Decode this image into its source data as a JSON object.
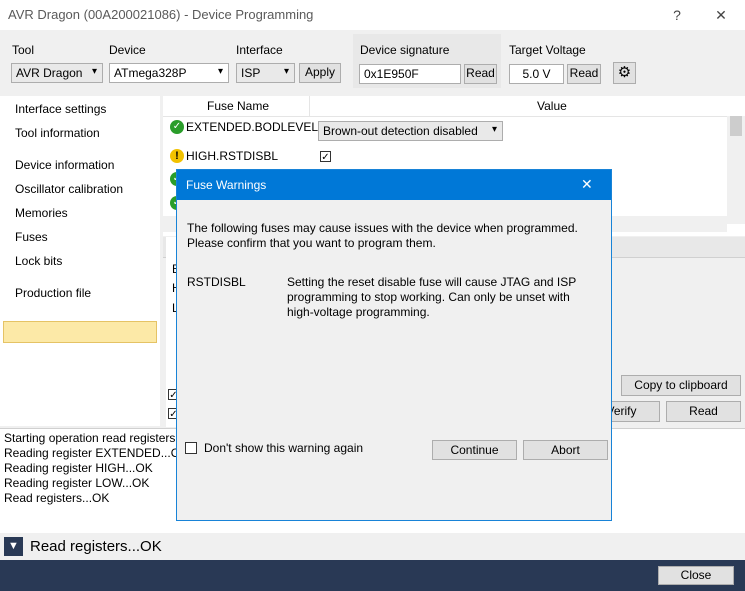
{
  "window": {
    "title": "AVR Dragon (00A200021086) - Device Programming",
    "help_glyph": "?",
    "close_glyph": "✕"
  },
  "toolbar": {
    "tool_label": "Tool",
    "tool_value": "AVR Dragon",
    "device_label": "Device",
    "device_value": "ATmega328P",
    "interface_label": "Interface",
    "interface_value": "ISP",
    "apply_label": "Apply",
    "signature_label": "Device signature",
    "signature_value": "0x1E950F",
    "signature_read": "Read",
    "voltage_label": "Target Voltage",
    "voltage_value": "5.0 V",
    "voltage_read": "Read"
  },
  "sidebar": {
    "items": [
      {
        "label": "Interface settings"
      },
      {
        "label": "Tool information"
      },
      {
        "label": "Device information"
      },
      {
        "label": "Oscillator calibration"
      },
      {
        "label": "Memories"
      },
      {
        "label": "Fuses"
      },
      {
        "label": "Lock bits"
      },
      {
        "label": "Production file"
      }
    ],
    "selected": "Fuses"
  },
  "fuse_table": {
    "col_name": "Fuse Name",
    "col_value": "Value",
    "rows": [
      {
        "name": "EXTENDED.BODLEVEL",
        "value": "Brown-out detection disabled",
        "status": "ok"
      },
      {
        "name": "HIGH.RSTDISBL",
        "value": "",
        "status": "warning"
      }
    ]
  },
  "background_peek": {
    "reg_label": "Fu",
    "r1": "E",
    "r2": "H",
    "r3": "L"
  },
  "right_buttons": {
    "copy": "Copy to clipboard",
    "verify": "Verify",
    "read": "Read"
  },
  "log": {
    "lines": [
      "Starting operation read registers",
      "Reading register EXTENDED...OK",
      "Reading register HIGH...OK",
      "Reading register LOW...OK",
      "Read registers...OK"
    ]
  },
  "status": {
    "text": "Read registers...OK"
  },
  "footer": {
    "close_label": "Close"
  },
  "dialog": {
    "title": "Fuse Warnings",
    "close_glyph": "✕",
    "intro_line1": "The following fuses may cause issues with the device when programmed.",
    "intro_line2": "Please confirm that you want to program them.",
    "fuse_name": "RSTDISBL",
    "fuse_desc1": "Setting the reset disable fuse will cause JTAG and ISP",
    "fuse_desc2": "programming to stop working. Can only be unset with",
    "fuse_desc3": "high-voltage programming.",
    "dont_show": "Don't show this warning again",
    "continue": "Continue",
    "abort": "Abort"
  }
}
